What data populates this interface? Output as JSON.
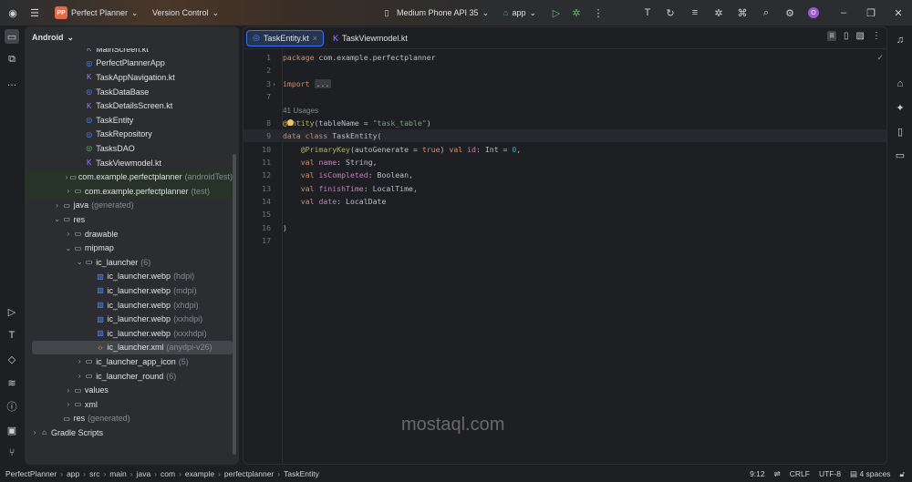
{
  "titlebar": {
    "project_initials": "PP",
    "project_name": "Perfect Planner",
    "vcs": "Version Control",
    "device": "Medium Phone API 35",
    "run_config": "app",
    "avatar_letter": "O"
  },
  "panel": {
    "title": "Android"
  },
  "tree": [
    {
      "label": "MainScreen.kt",
      "depth": 4,
      "icon": "kotlin-file",
      "partial": true
    },
    {
      "label": "PerfectPlannerApp",
      "depth": 4,
      "icon": "class"
    },
    {
      "label": "TaskAppNavigation.kt",
      "depth": 4,
      "icon": "kotlin-file"
    },
    {
      "label": "TaskDataBase",
      "depth": 4,
      "icon": "class"
    },
    {
      "label": "TaskDetailsScreen.kt",
      "depth": 4,
      "icon": "kotlin-file"
    },
    {
      "label": "TaskEntity",
      "depth": 4,
      "icon": "class"
    },
    {
      "label": "TaskRepository",
      "depth": 4,
      "icon": "class"
    },
    {
      "label": "TasksDAO",
      "depth": 4,
      "icon": "interface"
    },
    {
      "label": "TaskViewmodel.kt",
      "depth": 4,
      "icon": "kotlin-file"
    },
    {
      "label": "com.example.perfectplanner",
      "hint": "(androidTest)",
      "depth": 3,
      "icon": "package",
      "arrow": "collapsed",
      "bg": true
    },
    {
      "label": "com.example.perfectplanner",
      "hint": "(test)",
      "depth": 3,
      "icon": "package",
      "arrow": "collapsed",
      "bg": true
    },
    {
      "label": "java",
      "hint": "(generated)",
      "depth": 2,
      "icon": "folder",
      "arrow": "collapsed"
    },
    {
      "label": "res",
      "depth": 2,
      "icon": "folder",
      "arrow": "expanded"
    },
    {
      "label": "drawable",
      "depth": 3,
      "icon": "folder",
      "arrow": "collapsed"
    },
    {
      "label": "mipmap",
      "depth": 3,
      "icon": "folder",
      "arrow": "expanded"
    },
    {
      "label": "ic_launcher",
      "hint": "(6)",
      "depth": 4,
      "icon": "folder",
      "arrow": "expanded"
    },
    {
      "label": "ic_launcher.webp",
      "hint": "(hdpi)",
      "depth": 5,
      "icon": "image"
    },
    {
      "label": "ic_launcher.webp",
      "hint": "(mdpi)",
      "depth": 5,
      "icon": "image"
    },
    {
      "label": "ic_launcher.webp",
      "hint": "(xhdpi)",
      "depth": 5,
      "icon": "image"
    },
    {
      "label": "ic_launcher.webp",
      "hint": "(xxhdpi)",
      "depth": 5,
      "icon": "image"
    },
    {
      "label": "ic_launcher.webp",
      "hint": "(xxxhdpi)",
      "depth": 5,
      "icon": "image"
    },
    {
      "label": "ic_launcher.xml",
      "hint": "(anydpi-v26)",
      "depth": 5,
      "icon": "xml",
      "selected": true
    },
    {
      "label": "ic_launcher_app_icon",
      "hint": "(5)",
      "depth": 4,
      "icon": "folder",
      "arrow": "collapsed"
    },
    {
      "label": "ic_launcher_round",
      "hint": "(6)",
      "depth": 4,
      "icon": "folder",
      "arrow": "collapsed"
    },
    {
      "label": "values",
      "depth": 3,
      "icon": "folder",
      "arrow": "collapsed"
    },
    {
      "label": "xml",
      "depth": 3,
      "icon": "folder",
      "arrow": "collapsed"
    },
    {
      "label": "res",
      "hint": "(generated)",
      "depth": 2,
      "icon": "folder"
    },
    {
      "label": "Gradle Scripts",
      "depth": 0,
      "icon": "gradle",
      "arrow": "collapsed"
    }
  ],
  "tabs": [
    {
      "label": "TaskEntity.kt",
      "active": true
    },
    {
      "label": "TaskViewmodel.kt",
      "active": false
    }
  ],
  "code": [
    {
      "n": "1",
      "parts": [
        [
          "kw",
          "package "
        ],
        [
          "",
          "com.example.perfectplanner"
        ]
      ]
    },
    {
      "n": "2",
      "parts": []
    },
    {
      "n": "3",
      "fold": true,
      "parts": [
        [
          "kw",
          "import "
        ],
        [
          "fold",
          "..."
        ]
      ]
    },
    {
      "n": "7",
      "parts": []
    },
    {
      "n": "",
      "parts": [
        [
          "usage",
          "41 Usages"
        ]
      ]
    },
    {
      "n": "8",
      "parts": [
        [
          "ann",
          "@Entity"
        ],
        [
          "",
          "(tableName = "
        ],
        [
          "str",
          "\"task_table\""
        ],
        [
          "",
          ")"
        ]
      ]
    },
    {
      "n": "9",
      "current": true,
      "parts": [
        [
          "kw",
          "data class "
        ],
        [
          "",
          "TaskEntity("
        ]
      ]
    },
    {
      "n": "10",
      "parts": [
        [
          "",
          "    "
        ],
        [
          "ann",
          "@PrimaryKey"
        ],
        [
          "",
          "(autoGenerate = "
        ],
        [
          "kw",
          "true"
        ],
        [
          "",
          ") "
        ],
        [
          "kw",
          "val "
        ],
        [
          "prop",
          "id"
        ],
        [
          "",
          ": Int = "
        ],
        [
          "numc",
          "0"
        ],
        [
          "",
          ","
        ]
      ]
    },
    {
      "n": "11",
      "parts": [
        [
          "",
          "    "
        ],
        [
          "kw",
          "val "
        ],
        [
          "prop",
          "name"
        ],
        [
          "",
          ": String,"
        ]
      ]
    },
    {
      "n": "12",
      "parts": [
        [
          "",
          "    "
        ],
        [
          "kw",
          "val "
        ],
        [
          "prop",
          "isCompleted"
        ],
        [
          "",
          ": Boolean,"
        ]
      ]
    },
    {
      "n": "13",
      "parts": [
        [
          "",
          "    "
        ],
        [
          "kw",
          "val "
        ],
        [
          "prop",
          "finishTime"
        ],
        [
          "",
          ": LocalTime,"
        ]
      ]
    },
    {
      "n": "14",
      "parts": [
        [
          "",
          "    "
        ],
        [
          "kw",
          "val "
        ],
        [
          "prop",
          "date"
        ],
        [
          "",
          ": LocalDate"
        ]
      ]
    },
    {
      "n": "15",
      "parts": []
    },
    {
      "n": "16",
      "parts": [
        [
          "",
          ")"
        ]
      ]
    },
    {
      "n": "17",
      "parts": []
    }
  ],
  "breadcrumb": [
    "PerfectPlanner",
    "app",
    "src",
    "main",
    "java",
    "com",
    "example",
    "perfectplanner",
    "TaskEntity"
  ],
  "status": {
    "position": "9:12",
    "line_sep": "CRLF",
    "encoding": "UTF-8",
    "indent": "4 spaces"
  },
  "watermark": "mostaql.com",
  "colors": {
    "accent": "#3574f0",
    "keyword": "#cf8e6d",
    "string": "#6aab73",
    "annotation": "#b3ae60",
    "property": "#c77dbb"
  }
}
